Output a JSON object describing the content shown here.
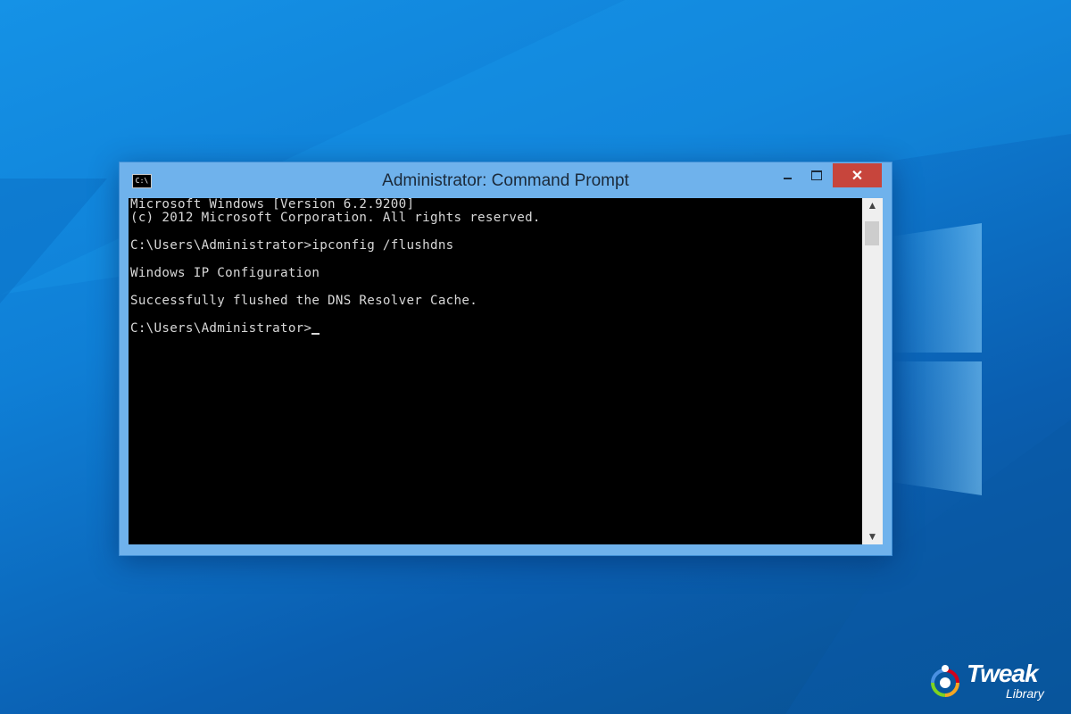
{
  "desktop": {
    "background_color": "#0f7fd6"
  },
  "window": {
    "title": "Administrator: Command Prompt",
    "app_icon_text": "C:\\",
    "close_label": "✕",
    "console_lines": [
      "Microsoft Windows [Version 6.2.9200]",
      "(c) 2012 Microsoft Corporation. All rights reserved.",
      "",
      "C:\\Users\\Administrator>ipconfig /flushdns",
      "",
      "Windows IP Configuration",
      "",
      "Successfully flushed the DNS Resolver Cache.",
      "",
      "C:\\Users\\Administrator>"
    ],
    "scroll_up_glyph": "▲",
    "scroll_down_glyph": "▼",
    "colors": {
      "frame": "#6fb2ec",
      "close": "#c7453c",
      "console_bg": "#000000",
      "console_text": "#d8d8d8"
    }
  },
  "brand": {
    "name": "Tweak",
    "sub": "Library",
    "icon": "tweak-library-logo-icon"
  }
}
